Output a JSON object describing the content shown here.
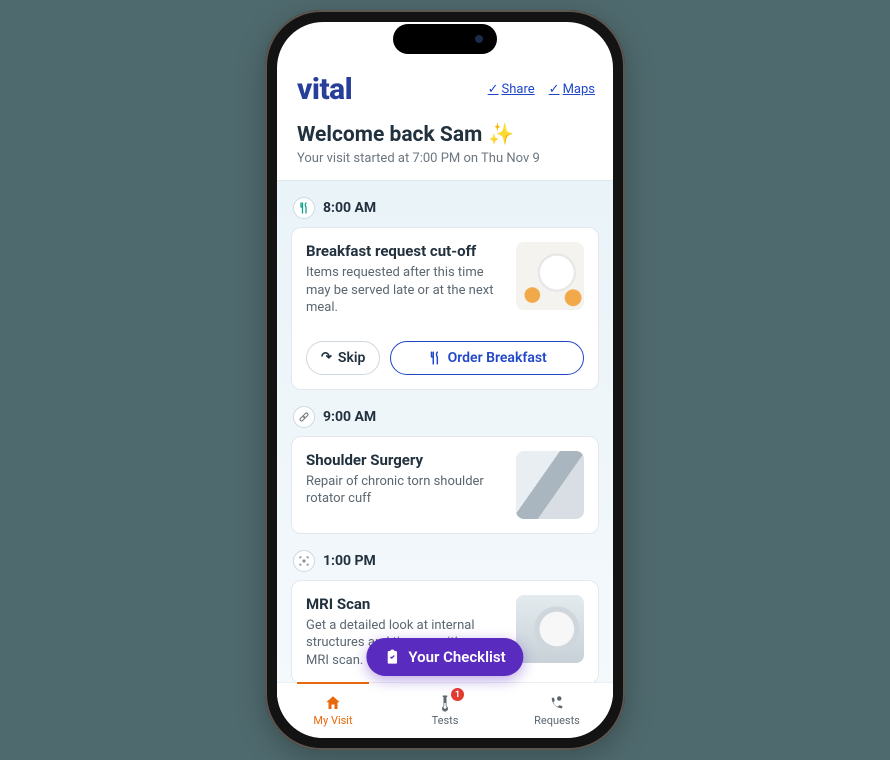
{
  "brand": "vital",
  "top_links": {
    "share": "Share",
    "maps": "Maps"
  },
  "hero": {
    "title": "Welcome back Sam",
    "subtitle": "Your visit started at 7:00 PM on Thu Nov 9"
  },
  "timeline": [
    {
      "time": "8:00 AM",
      "icon": "utensils",
      "title": "Breakfast request cut-off",
      "body": "Items requested after this time may be served late or at the next meal.",
      "actions": {
        "skip": "Skip",
        "primary": "Order Breakfast"
      }
    },
    {
      "time": "9:00 AM",
      "icon": "bandage",
      "title": "Shoulder Surgery",
      "body": "Repair of chronic torn shoulder rotator cuff"
    },
    {
      "time": "1:00 PM",
      "icon": "scan",
      "title": "MRI Scan",
      "body": "Get a detailed look at internal structures and tissues with an MRI scan."
    }
  ],
  "fab_label": "Your Checklist",
  "tabs": {
    "visit": "My Visit",
    "tests": "Tests",
    "tests_badge": "1",
    "requests": "Requests"
  }
}
